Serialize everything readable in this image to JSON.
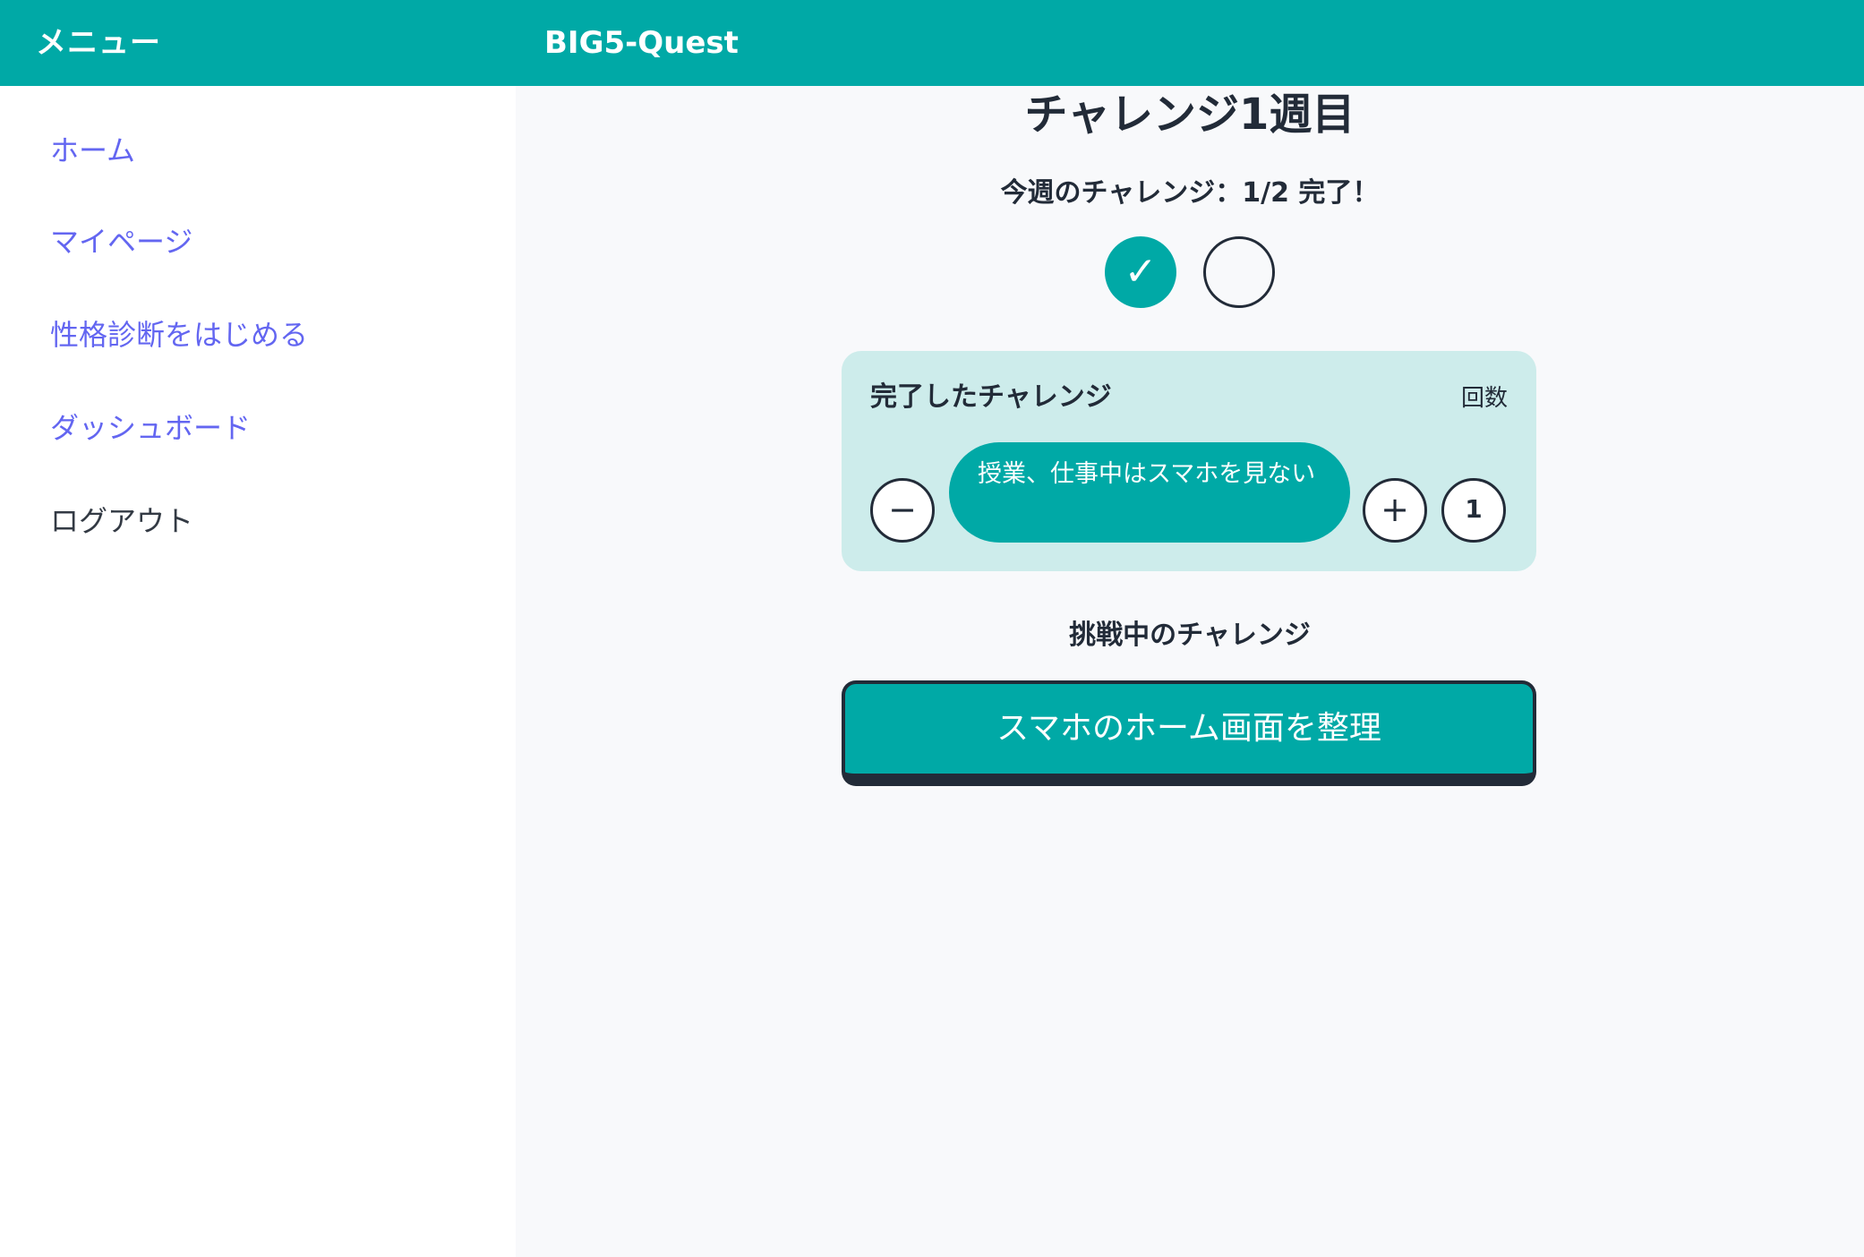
{
  "header": {
    "menu_title": "メニュー",
    "app_title": "BIG5-Quest"
  },
  "sidebar": {
    "items": [
      {
        "label": "ホーム"
      },
      {
        "label": "マイページ"
      },
      {
        "label": "性格診断をはじめる"
      },
      {
        "label": "ダッシュボード"
      },
      {
        "label": "ログアウト"
      }
    ]
  },
  "main": {
    "title": "チャレンジ1週目",
    "week_status": "今週のチャレンジ：1/2 完了！",
    "progress": {
      "completed": 1,
      "total": 2,
      "check_glyph": "✓"
    },
    "completed_section": {
      "title": "完了したチャレンジ",
      "count_label": "回数",
      "minus_glyph": "−",
      "plus_glyph": "+",
      "item": {
        "label": "授業、仕事中はスマホを見ない",
        "count": "1"
      }
    },
    "in_progress_section": {
      "title": "挑戦中のチャレンジ",
      "item_label": "スマホのホーム画面を整理"
    }
  },
  "colors": {
    "brand_teal": "#00a9a6",
    "link_purple": "#6366f1",
    "card_bg": "#cdeceb",
    "dark_text": "#222b38"
  }
}
